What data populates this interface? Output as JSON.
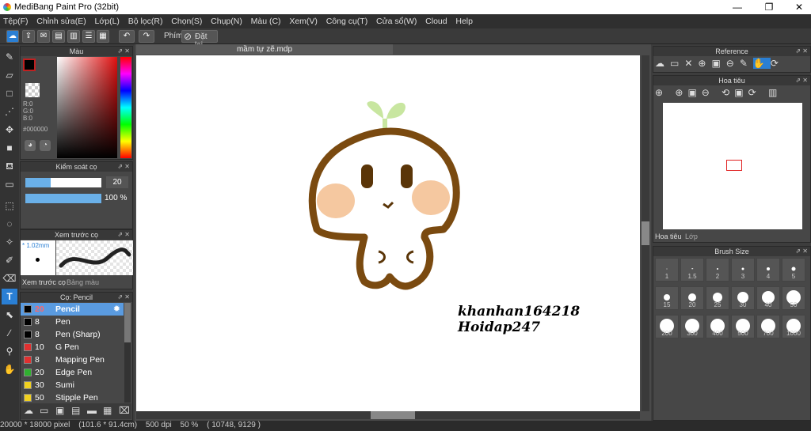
{
  "app": {
    "title": "MediBang Paint Pro (32bit)"
  },
  "window_controls": {
    "minimize": "—",
    "maximize": "❐",
    "close": "✕"
  },
  "menu": [
    "Tệp(F)",
    "Chỉnh sửa(E)",
    "Lớp(L)",
    "Bộ lọc(R)",
    "Chọn(S)",
    "Chụp(N)",
    "Màu (C)",
    "Xem(V)",
    "Công cụ(T)",
    "Cửa sổ(W)",
    "Cloud",
    "Help"
  ],
  "toolbar": {
    "key_label": "Phím",
    "reset_label": "Đặt lại"
  },
  "document": {
    "tab": "mầm tự zẽ.mdp"
  },
  "color_panel": {
    "title": "Màu",
    "r": "R:0",
    "g": "G:0",
    "b": "B:0",
    "hex": "#000000"
  },
  "brush_control": {
    "title": "Kiểm soát cọ",
    "size": "20",
    "opacity": "100 %",
    "size_fill": 0.33,
    "opacity_fill": 1.0
  },
  "brush_preview": {
    "title": "Xem trước cọ",
    "size_text": "* 1.02mm",
    "tab_preview": "Xem trước cọ",
    "tab_palette": "Bảng màu"
  },
  "brush_list": {
    "title": "Cọ: Pencil",
    "items": [
      {
        "num": "20",
        "name": "Pencil",
        "color": "#000000",
        "selected": true
      },
      {
        "num": "8",
        "name": "Pen",
        "color": "#000000"
      },
      {
        "num": "8",
        "name": "Pen (Sharp)",
        "color": "#000000"
      },
      {
        "num": "10",
        "name": "G Pen",
        "color": "#e03030"
      },
      {
        "num": "8",
        "name": "Mapping Pen",
        "color": "#e03030"
      },
      {
        "num": "20",
        "name": "Edge Pen",
        "color": "#30b030"
      },
      {
        "num": "30",
        "name": "Sumi",
        "color": "#f0d020"
      },
      {
        "num": "50",
        "name": "Stipple Pen",
        "color": "#f0d020"
      }
    ]
  },
  "canvas_text": {
    "line1": "khanhan164218",
    "line2": "Hoidap247"
  },
  "reference_panel": {
    "title": "Reference"
  },
  "navigator_panel": {
    "title": "Hoa tiêu",
    "tab_nav": "Hoa tiêu",
    "tab_layer": "Lớp"
  },
  "brush_size_panel": {
    "title": "Brush Size",
    "sizes": [
      "1",
      "1.5",
      "2",
      "3",
      "4",
      "5",
      "15",
      "20",
      "25",
      "30",
      "40",
      "50",
      "200",
      "300",
      "400",
      "500",
      "700",
      "1000"
    ]
  },
  "status": {
    "pixels": "20000 * 18000 pixel",
    "cm": "(101.6 * 91.4cm)",
    "dpi": "500 dpi",
    "zoom": "50 %",
    "coords": "( 10748, 9129 )"
  },
  "colors": {
    "accent": "#2a7fd4",
    "outline": "#7a4a10",
    "sprout": "#c8e6a0",
    "cheek": "#f5c8a0"
  }
}
